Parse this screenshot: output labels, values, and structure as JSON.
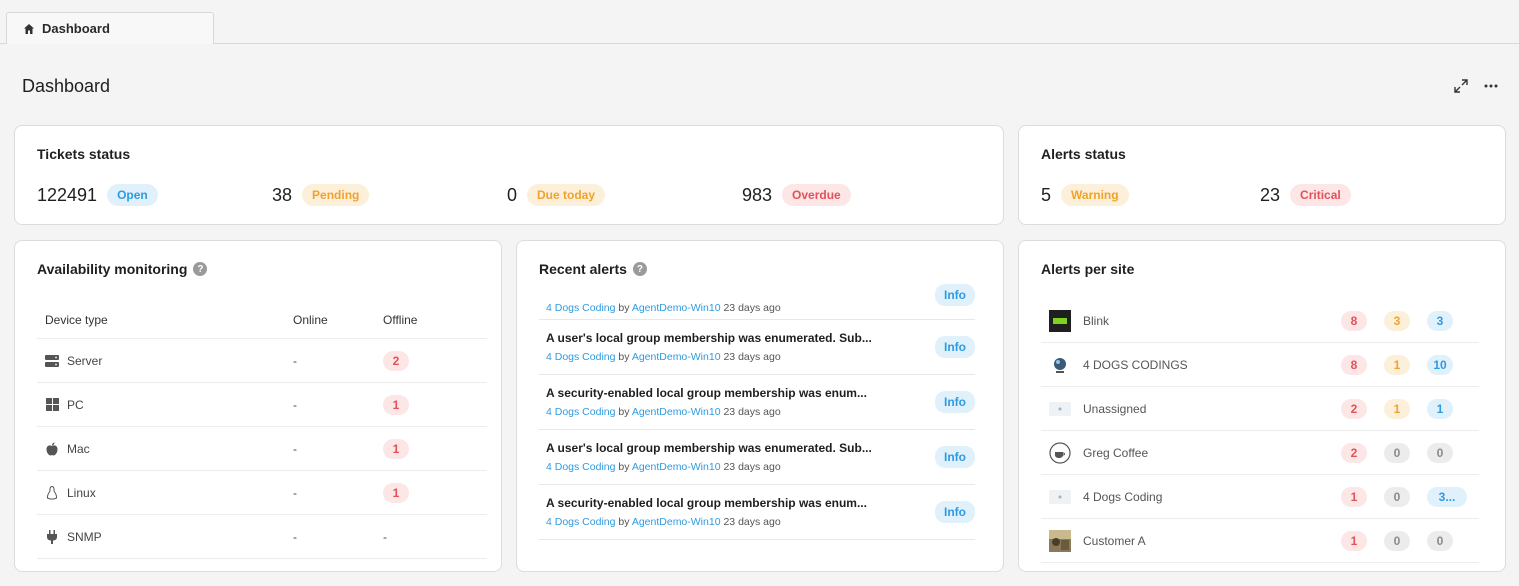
{
  "tab": {
    "label": "Dashboard",
    "icon": "home-icon"
  },
  "page": {
    "title": "Dashboard",
    "icons": [
      "expand-icon",
      "more-icon"
    ]
  },
  "tickets": {
    "title": "Tickets status",
    "stats": [
      {
        "value": "122491",
        "label": "Open",
        "color": "blue"
      },
      {
        "value": "38",
        "label": "Pending",
        "color": "orange"
      },
      {
        "value": "0",
        "label": "Due today",
        "color": "orange"
      },
      {
        "value": "983",
        "label": "Overdue",
        "color": "red"
      }
    ]
  },
  "alerts_status": {
    "title": "Alerts status",
    "stats": [
      {
        "value": "5",
        "label": "Warning",
        "color": "orange"
      },
      {
        "value": "23",
        "label": "Critical",
        "color": "red"
      }
    ]
  },
  "availability": {
    "title": "Availability monitoring",
    "help": "?",
    "columns": [
      "Device type",
      "Online",
      "Offline"
    ],
    "rows": [
      {
        "type": "Server",
        "icon": "server-icon",
        "online": "-",
        "offline": "2"
      },
      {
        "type": "PC",
        "icon": "windows-icon",
        "online": "-",
        "offline": "1"
      },
      {
        "type": "Mac",
        "icon": "apple-icon",
        "online": "-",
        "offline": "1"
      },
      {
        "type": "Linux",
        "icon": "linux-icon",
        "online": "-",
        "offline": "1"
      },
      {
        "type": "SNMP",
        "icon": "plug-icon",
        "online": "-",
        "offline": "-"
      }
    ]
  },
  "recent_alerts": {
    "title": "Recent alerts",
    "help": "?",
    "items": [
      {
        "title": "",
        "site": "4 Dogs Coding",
        "by": "by",
        "agent": "AgentDemo-Win10",
        "when": "23 days ago",
        "level": "Info"
      },
      {
        "title": "A user's local group membership was enumerated. Sub...",
        "site": "4 Dogs Coding",
        "by": "by",
        "agent": "AgentDemo-Win10",
        "when": "23 days ago",
        "level": "Info"
      },
      {
        "title": "A security-enabled local group membership was enum...",
        "site": "4 Dogs Coding",
        "by": "by",
        "agent": "AgentDemo-Win10",
        "when": "23 days ago",
        "level": "Info"
      },
      {
        "title": "A user's local group membership was enumerated. Sub...",
        "site": "4 Dogs Coding",
        "by": "by",
        "agent": "AgentDemo-Win10",
        "when": "23 days ago",
        "level": "Info"
      },
      {
        "title": "A security-enabled local group membership was enum...",
        "site": "4 Dogs Coding",
        "by": "by",
        "agent": "AgentDemo-Win10",
        "when": "23 days ago",
        "level": "Info"
      }
    ]
  },
  "alerts_per_site": {
    "title": "Alerts per site",
    "rows": [
      {
        "name": "Blink",
        "logo": "blink-logo",
        "red": "8",
        "orange": "3",
        "blue": "3",
        "orange_gray": false,
        "blue_gray": false
      },
      {
        "name": "4 DOGS CODINGS",
        "logo": "globe-logo",
        "red": "8",
        "orange": "1",
        "blue": "10",
        "orange_gray": false,
        "blue_gray": false
      },
      {
        "name": "Unassigned",
        "logo": "placeholder-logo",
        "red": "2",
        "orange": "1",
        "blue": "1",
        "orange_gray": false,
        "blue_gray": false
      },
      {
        "name": "Greg Coffee",
        "logo": "coffee-logo",
        "red": "2",
        "orange": "0",
        "blue": "0",
        "orange_gray": true,
        "blue_gray": true
      },
      {
        "name": "4 Dogs Coding",
        "logo": "placeholder-logo",
        "red": "1",
        "orange": "0",
        "blue": "3...",
        "orange_gray": true,
        "blue_gray": false
      },
      {
        "name": "Customer A",
        "logo": "photo-logo",
        "red": "1",
        "orange": "0",
        "blue": "0",
        "orange_gray": true,
        "blue_gray": true
      }
    ]
  }
}
